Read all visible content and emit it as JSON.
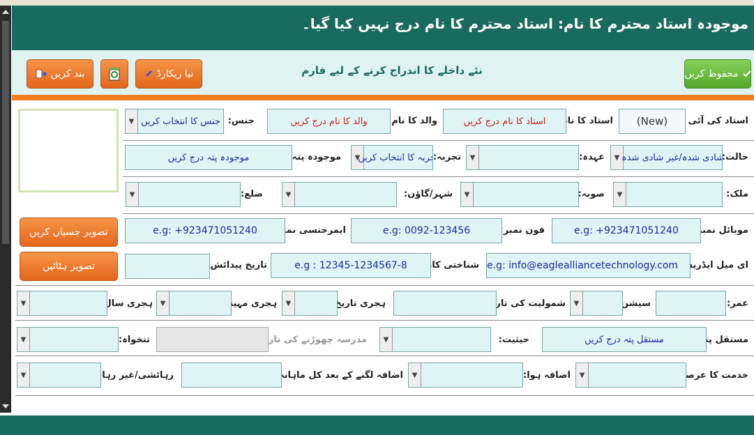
{
  "header": {
    "title": "موجودہ استاد محترم کا نام:   استاد محترم کا نام درج نہیں کیا گیا۔"
  },
  "toolbar": {
    "save_label": "محفوظ کریں",
    "form_title": "نئے داخلے کا اندراج کرنے کے لیے فارم",
    "new_label": "نیا ریکارڈ",
    "close_label": "بند کریں"
  },
  "photo": {
    "paste_label": "تصویر چسپاں کریں",
    "remove_label": "تصویر ہٹائیں"
  },
  "row1": {
    "teacher_id_label": "استاد کی آئی ڈی:",
    "teacher_id_value": "(New)",
    "teacher_name_label": "استاد کا نام:",
    "teacher_name_ph": "استاد کا نام درج کریں",
    "father_name_label": "والد کا نام:",
    "father_name_ph": "والد کا نام درج کریں",
    "gender_label": "جنس:",
    "gender_value": "جنس کا انتخاب کریں"
  },
  "row2": {
    "status_label": "حالت:",
    "status_value": "شادی شدہ/غیر شادی شدہ",
    "designation_label": "عہدہ:",
    "designation_value": "",
    "experience_label": "تجربہ:",
    "experience_value": "تجربہ کا انتخاب کریں",
    "address_label": "موجودہ پتہ:",
    "address_ph": "موجودہ پتہ درج کریں"
  },
  "row3": {
    "country_label": "ملک:",
    "province_label": "صوبہ:",
    "city_label": "شہر/گاؤں:",
    "district_label": "ضلع:"
  },
  "row4": {
    "mobile_label": "موبائل نمبر:",
    "mobile_ph": "e.g: +923471051240",
    "phone_label": "فون نمبر:",
    "phone_ph": "e.g: 0092-123456",
    "emergency_label": "ایمرجنسی نمبر:",
    "emergency_ph": "e.g: +923471051240"
  },
  "row5": {
    "email_label": "ای میل ایڈریس:",
    "email_ph": "e.g: info@eaglealliancetechnology.com",
    "cnic_label": "شناختی کارڈ نمبر",
    "cnic_ph": "e.g : 12345-1234567-8",
    "dob_label": "تاریخ پیدائش:"
  },
  "row6": {
    "age_label": "عمر:",
    "session_label": "سیشن:",
    "joining_label": "شمولیت کی تاریخ:",
    "hijri_date_label": "ہجری تاریخ:",
    "hijri_month_label": "ہجری مہینا:",
    "hijri_year_label": "ہجری سال:"
  },
  "row7": {
    "perm_address_label": "مستقل پتہ:",
    "perm_address_ph": "مستقل پتہ درج کریں",
    "position_label": "حیثیت:",
    "leave_date_label": "مدرسہ چھوڑنے کی تاریخ:",
    "salary_label": "تنخواہ:"
  },
  "row8": {
    "service_label": "خدمت کا عرصہ:",
    "increment_label": "اضافہ ہوا:",
    "total_salary_label": "اضافہ لگنے کے بعد کل ماہانہ تنخواہ:",
    "residence_label": "رہائشی/غیر رہائشی:"
  },
  "colors": {
    "header": "#1a6b5f",
    "accent": "#ef7d22",
    "field": "#dff4f4",
    "save": "#56a82c"
  }
}
